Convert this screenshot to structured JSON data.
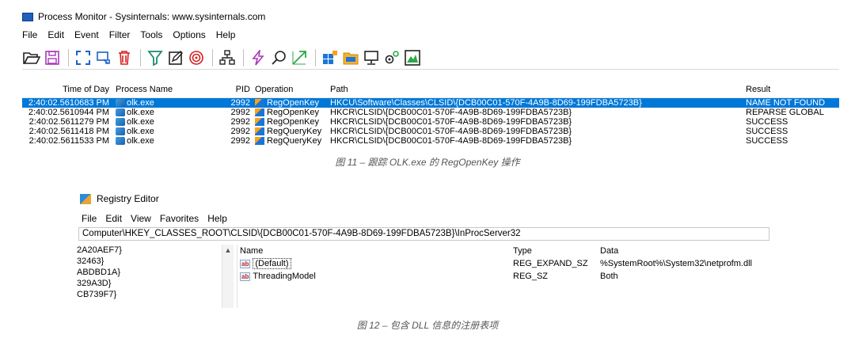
{
  "procmon": {
    "title": "Process Monitor - Sysinternals: www.sysinternals.com",
    "menu": [
      "File",
      "Edit",
      "Event",
      "Filter",
      "Tools",
      "Options",
      "Help"
    ],
    "toolbar_icons": [
      "open-icon",
      "save-icon",
      "autoscroll-icon",
      "capture-icon",
      "clear-icon",
      "filter-icon",
      "highlight-icon",
      "target-icon",
      "process-tree-icon",
      "event-icon",
      "find-icon",
      "jump-icon",
      "registry-icon",
      "filesystem-icon",
      "network-icon",
      "process-activity-icon",
      "profiling-icon"
    ],
    "columns": {
      "time": "Time of Day",
      "process": "Process Name",
      "pid": "PID",
      "operation": "Operation",
      "path": "Path",
      "result": "Result"
    },
    "rows": [
      {
        "time": "2:40:02.5610683 PM",
        "process": "olk.exe",
        "pid": "2992",
        "operation": "RegOpenKey",
        "path": "HKCU\\Software\\Classes\\CLSID\\{DCB00C01-570F-4A9B-8D69-199FDBA5723B}",
        "result": "NAME NOT FOUND"
      },
      {
        "time": "2:40:02.5610944 PM",
        "process": "olk.exe",
        "pid": "2992",
        "operation": "RegOpenKey",
        "path": "HKCR\\CLSID\\{DCB00C01-570F-4A9B-8D69-199FDBA5723B}",
        "result": "REPARSE GLOBAL"
      },
      {
        "time": "2:40:02.5611279 PM",
        "process": "olk.exe",
        "pid": "2992",
        "operation": "RegOpenKey",
        "path": "HKCR\\CLSID\\{DCB00C01-570F-4A9B-8D69-199FDBA5723B}",
        "result": "SUCCESS"
      },
      {
        "time": "2:40:02.5611418 PM",
        "process": "olk.exe",
        "pid": "2992",
        "operation": "RegQueryKey",
        "path": "HKCR\\CLSID\\{DCB00C01-570F-4A9B-8D69-199FDBA5723B}",
        "result": "SUCCESS"
      },
      {
        "time": "2:40:02.5611533 PM",
        "process": "olk.exe",
        "pid": "2992",
        "operation": "RegQueryKey",
        "path": "HKCR\\CLSID\\{DCB00C01-570F-4A9B-8D69-199FDBA5723B}",
        "result": "SUCCESS"
      }
    ],
    "caption": "图 11 – 跟踪 OLK.exe 的 RegOpenKey 操作"
  },
  "regedit": {
    "title": "Registry Editor",
    "menu": [
      "File",
      "Edit",
      "View",
      "Favorites",
      "Help"
    ],
    "address": "Computer\\HKEY_CLASSES_ROOT\\CLSID\\{DCB00C01-570F-4A9B-8D69-199FDBA5723B}\\InProcServer32",
    "tree": [
      "2A20AEF7}",
      "32463}",
      "ABDBD1A}",
      "329A3D}",
      "CB739F7}"
    ],
    "columns": {
      "name": "Name",
      "type": "Type",
      "data": "Data"
    },
    "values": [
      {
        "name": "(Default)",
        "type": "REG_EXPAND_SZ",
        "data": "%SystemRoot%\\System32\\netprofm.dll"
      },
      {
        "name": "ThreadingModel",
        "type": "REG_SZ",
        "data": "Both"
      }
    ],
    "caption": "图 12 – 包含 DLL 信息的注册表项"
  },
  "colors": {
    "selection": "#0078d7",
    "caption": "#555555"
  }
}
